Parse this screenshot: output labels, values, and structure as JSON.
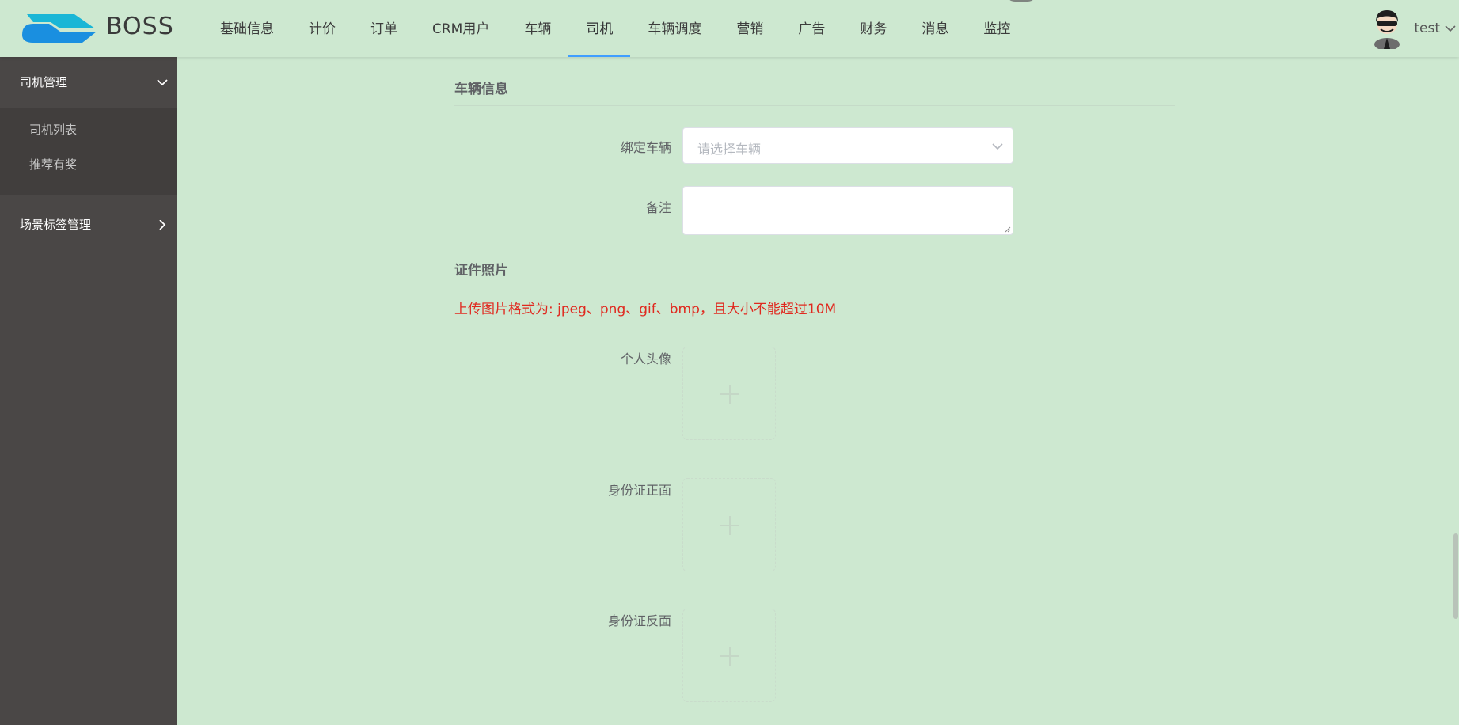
{
  "header": {
    "brand": "BOSS",
    "nav": [
      {
        "label": "基础信息"
      },
      {
        "label": "计价"
      },
      {
        "label": "订单"
      },
      {
        "label": "CRM用户"
      },
      {
        "label": "车辆"
      },
      {
        "label": "司机",
        "active": true
      },
      {
        "label": "车辆调度"
      },
      {
        "label": "营销"
      },
      {
        "label": "广告"
      },
      {
        "label": "财务"
      },
      {
        "label": "消息"
      },
      {
        "label": "监控"
      }
    ],
    "username": "test"
  },
  "sidebar": {
    "groups": [
      {
        "label": "司机管理",
        "expanded": true,
        "items": [
          {
            "label": "司机列表"
          },
          {
            "label": "推荐有奖"
          }
        ]
      },
      {
        "label": "场景标签管理",
        "expanded": false
      }
    ]
  },
  "form": {
    "vehicle_section_title": "车辆信息",
    "bind_vehicle_label": "绑定车辆",
    "bind_vehicle_placeholder": "请选择车辆",
    "remark_label": "备注",
    "remark_value": "",
    "photo_section_title": "证件照片",
    "upload_hint": "上传图片格式为: jpeg、png、gif、bmp，且大小不能超过10M",
    "uploads": [
      {
        "label": "个人头像"
      },
      {
        "label": "身份证正面"
      },
      {
        "label": "身份证反面"
      }
    ]
  },
  "colors": {
    "background": "#cde8d0",
    "sidebar": "#4a4746",
    "accent": "#409eff",
    "hint_red": "#e0291f"
  },
  "icons": [
    "logo-icon",
    "avatar-icon",
    "chevron-down-icon",
    "chevron-right-icon",
    "plus-icon"
  ]
}
